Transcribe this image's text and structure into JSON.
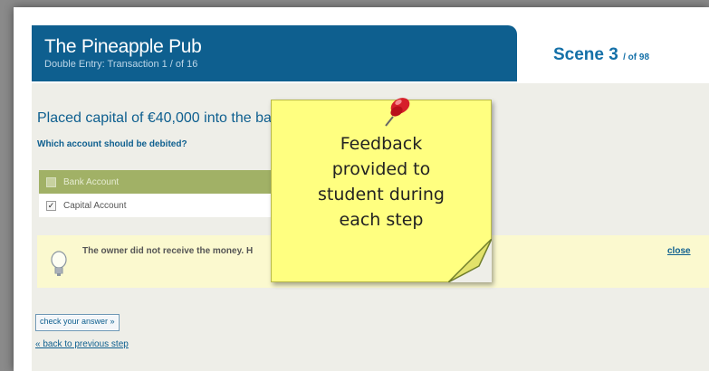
{
  "header": {
    "app_title": "The Pineapple Pub",
    "subtitle": "Double Entry: Transaction 1 / of 16",
    "scene_label": "Scene 3",
    "scene_total": "/ of 98"
  },
  "question": {
    "title": "Placed capital of €40,000 into the bani",
    "prompt": "Which account should be debited?",
    "options": [
      {
        "label": "Bank Account",
        "checked": false
      },
      {
        "label": "Capital Account",
        "checked": true
      }
    ]
  },
  "feedback": {
    "text": "The owner did not receive the money. H",
    "close_label": "close"
  },
  "actions": {
    "check_label": "check your answer »",
    "back_label": "« back to previous step"
  },
  "annotation": {
    "note_lines": [
      "Feedback",
      "provided to",
      "student during",
      "each step"
    ]
  },
  "colors": {
    "header_blue": "#0e5f8f",
    "option_green": "#a1b166",
    "feedback_yellow": "#fbf9cf",
    "note_yellow": "#ffff80",
    "pin_red": "#d6202a"
  },
  "icons": {
    "tip": "lightbulb-icon",
    "pin": "pushpin-icon"
  }
}
